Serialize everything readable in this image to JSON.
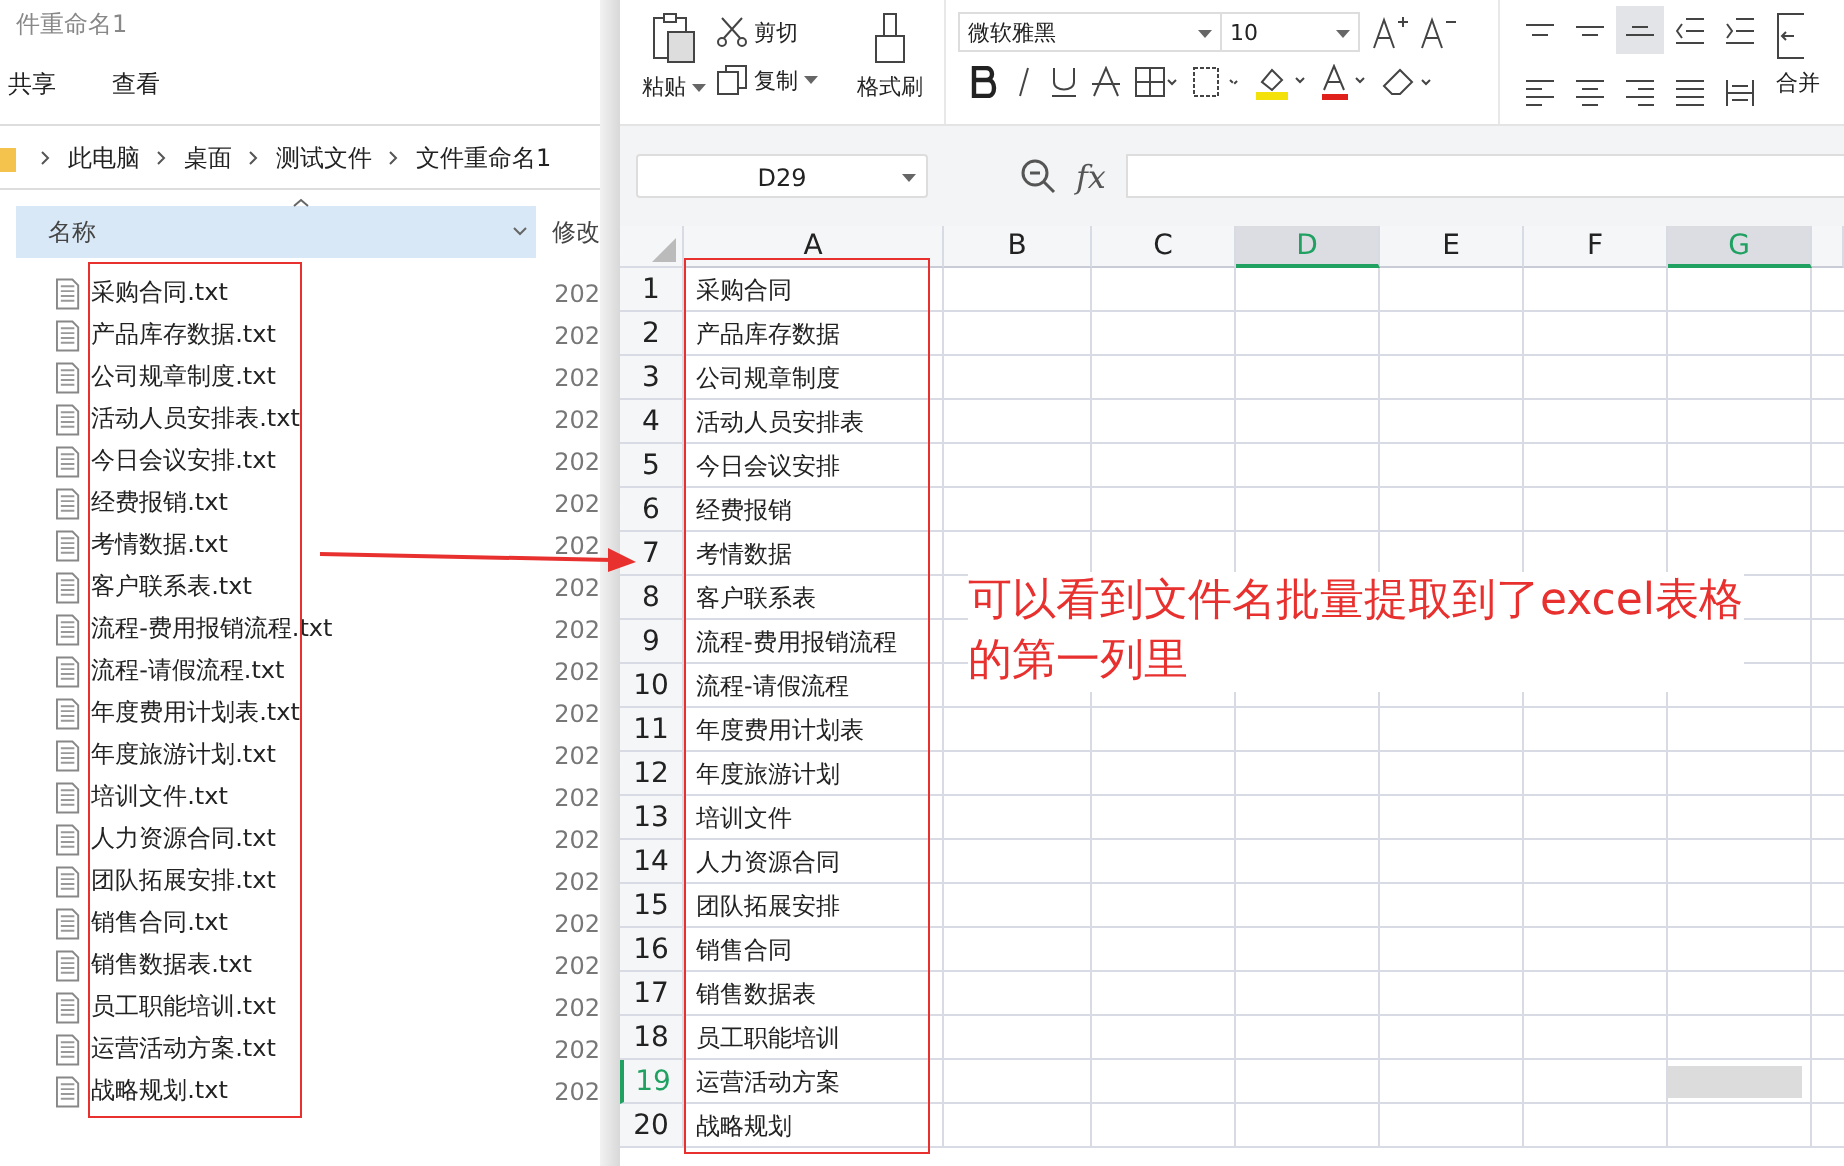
{
  "explorer": {
    "title": "件重命名1",
    "tabs": [
      "共享",
      "查看"
    ],
    "breadcrumb": [
      "此电脑",
      "桌面",
      "测试文件",
      "文件重命名1"
    ],
    "columns": {
      "name": "名称",
      "modified": "修改"
    },
    "files": [
      {
        "name": "采购合同.txt",
        "date": "202"
      },
      {
        "name": "产品库存数据.txt",
        "date": "202"
      },
      {
        "name": "公司规章制度.txt",
        "date": "202"
      },
      {
        "name": "活动人员安排表.txt",
        "date": "202"
      },
      {
        "name": "今日会议安排.txt",
        "date": "202"
      },
      {
        "name": "经费报销.txt",
        "date": "202"
      },
      {
        "name": "考情数据.txt",
        "date": "202"
      },
      {
        "name": "客户联系表.txt",
        "date": "202"
      },
      {
        "name": "流程-费用报销流程.txt",
        "date": "202"
      },
      {
        "name": "流程-请假流程.txt",
        "date": "202"
      },
      {
        "name": "年度费用计划表.txt",
        "date": "202"
      },
      {
        "name": "年度旅游计划.txt",
        "date": "202"
      },
      {
        "name": "培训文件.txt",
        "date": "202"
      },
      {
        "name": "人力资源合同.txt",
        "date": "202"
      },
      {
        "name": "团队拓展安排.txt",
        "date": "202"
      },
      {
        "name": "销售合同.txt",
        "date": "202"
      },
      {
        "name": "销售数据表.txt",
        "date": "202"
      },
      {
        "name": "员工职能培训.txt",
        "date": "202"
      },
      {
        "name": "运营活动方案.txt",
        "date": "202"
      },
      {
        "name": "战略规划.txt",
        "date": "202"
      }
    ]
  },
  "spreadsheet": {
    "toolbar": {
      "paste": "粘贴",
      "cut": "剪切",
      "copy": "复制",
      "format_painter": "格式刷",
      "font": "微软雅黑",
      "size": "10",
      "merge": "合并",
      "align_buttons": [
        {
          "kind": "top",
          "selected": false
        },
        {
          "kind": "middle",
          "selected": false
        },
        {
          "kind": "bottom",
          "selected": true
        },
        {
          "kind": "outdent",
          "selected": false
        },
        {
          "kind": "indent",
          "selected": false
        },
        {
          "kind": "left",
          "selected": false
        },
        {
          "kind": "center",
          "selected": false
        },
        {
          "kind": "right",
          "selected": false
        },
        {
          "kind": "justify",
          "selected": false
        },
        {
          "kind": "distribute",
          "selected": false
        }
      ]
    },
    "name_box": "D29",
    "function_label": "fx",
    "columns": [
      {
        "label": "A",
        "selected": false
      },
      {
        "label": "B",
        "selected": false
      },
      {
        "label": "C",
        "selected": false
      },
      {
        "label": "D",
        "selected": true
      },
      {
        "label": "E",
        "selected": false
      },
      {
        "label": "F",
        "selected": false
      },
      {
        "label": "G",
        "selected": true
      }
    ],
    "rows": [
      {
        "number": "1",
        "cell_a": "采购合同",
        "selected": false
      },
      {
        "number": "2",
        "cell_a": "产品库存数据",
        "selected": false
      },
      {
        "number": "3",
        "cell_a": "公司规章制度",
        "selected": false
      },
      {
        "number": "4",
        "cell_a": "活动人员安排表",
        "selected": false
      },
      {
        "number": "5",
        "cell_a": "今日会议安排",
        "selected": false
      },
      {
        "number": "6",
        "cell_a": "经费报销",
        "selected": false
      },
      {
        "number": "7",
        "cell_a": "考情数据",
        "selected": false
      },
      {
        "number": "8",
        "cell_a": "客户联系表",
        "selected": false
      },
      {
        "number": "9",
        "cell_a": "流程-费用报销流程",
        "selected": false
      },
      {
        "number": "10",
        "cell_a": "流程-请假流程",
        "selected": false
      },
      {
        "number": "11",
        "cell_a": "年度费用计划表",
        "selected": false
      },
      {
        "number": "12",
        "cell_a": "年度旅游计划",
        "selected": false
      },
      {
        "number": "13",
        "cell_a": "培训文件",
        "selected": false
      },
      {
        "number": "14",
        "cell_a": "人力资源合同",
        "selected": false
      },
      {
        "number": "15",
        "cell_a": "团队拓展安排",
        "selected": false
      },
      {
        "number": "16",
        "cell_a": "销售合同",
        "selected": false
      },
      {
        "number": "17",
        "cell_a": "销售数据表",
        "selected": false
      },
      {
        "number": "18",
        "cell_a": "员工职能培训",
        "selected": false
      },
      {
        "number": "19",
        "cell_a": "运营活动方案",
        "selected": true
      },
      {
        "number": "20",
        "cell_a": "战略规划",
        "selected": false
      }
    ]
  },
  "annotation": [
    "可以看到文件名批量提取到了excel表格",
    "的第一列里"
  ]
}
